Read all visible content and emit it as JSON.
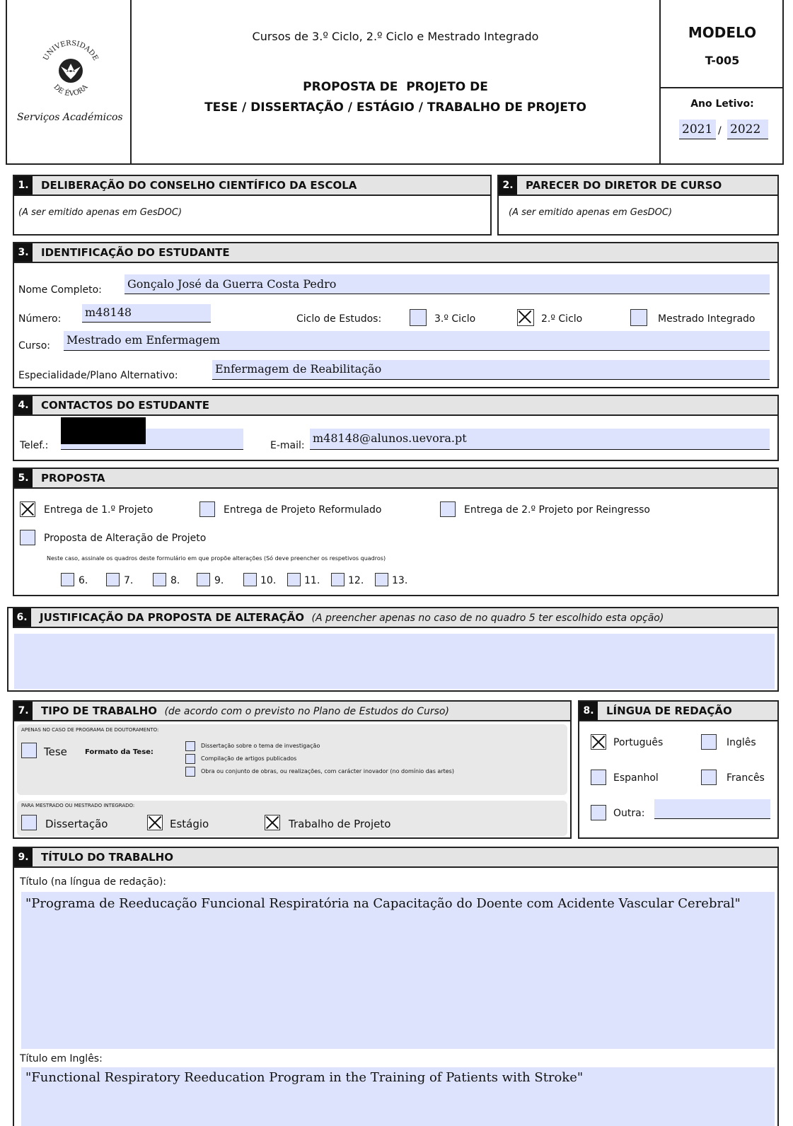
{
  "header": {
    "university_name": "UNIVERSIDADE DE ÉVORA",
    "services": "Serviços Académicos",
    "courses": "Cursos de 3.º Ciclo, 2.º Ciclo e Mestrado Integrado",
    "title_line1": "PROPOSTA DE  PROJETO DE",
    "title_line2": "TESE / DISSERTAÇÃO / ESTÁGIO / TRABALHO DE PROJETO",
    "model_label": "MODELO",
    "model_code": "T-005",
    "year_label": "Ano Letivo:",
    "year_start": "2021",
    "year_sep": "/",
    "year_end": "2022"
  },
  "s1": {
    "num": "1.",
    "title": "DELIBERAÇÃO DO CONSELHO CIENTÍFICO DA ESCOLA",
    "note": "(A ser emitido apenas em GesDOC)"
  },
  "s2": {
    "num": "2.",
    "title": "PARECER DO DIRETOR DE CURSO",
    "note": "(A ser emitido apenas em GesDOC)"
  },
  "s3": {
    "num": "3.",
    "title": "IDENTIFICAÇÃO DO ESTUDANTE",
    "name_label": "Nome Completo:",
    "name_value": "Gonçalo José da Guerra Costa Pedro",
    "number_label": "Número:",
    "number_value": "m48148",
    "cycle_label": "Ciclo de Estudos:",
    "cycle3": "3.º Ciclo",
    "cycle2": "2.º Ciclo",
    "integrated": "Mestrado Integrado",
    "course_label": "Curso:",
    "course_value": "Mestrado em Enfermagem",
    "spec_label": "Especialidade/Plano Alternativo:",
    "spec_value": "Enfermagem de Reabilitação"
  },
  "s4": {
    "num": "4.",
    "title": "CONTACTOS DO ESTUDANTE",
    "phone_label": "Telef.:",
    "email_label": "E-mail:",
    "email_value": "m48148@alunos.uevora.pt"
  },
  "s5": {
    "num": "5.",
    "title": "PROPOSTA",
    "opt1": "Entrega de 1.º Projeto",
    "opt2": "Entrega de Projeto Reformulado",
    "opt3": "Entrega de 2.º Projeto por Reingresso",
    "opt4": "Proposta de Alteração de Projeto",
    "note": "Neste caso, assinale os quadros deste formulário em que propõe alterações (Só deve preencher os respetivos quadros)",
    "quadros": [
      "6.",
      "7.",
      "8.",
      "9.",
      "10.",
      "11.",
      "12.",
      "13."
    ]
  },
  "s6": {
    "num": "6.",
    "title": "JUSTIFICAÇÃO DA PROPOSTA DE ALTERAÇÃO",
    "note": "(A preencher apenas no caso de no quadro 5 ter escolhido esta opção)"
  },
  "s7": {
    "num": "7.",
    "title": "TIPO DE TRABALHO",
    "note": "(de acordo com o previsto no Plano de Estudos do Curso)",
    "phd_label": "APENAS NO CASO DE PROGRAMA DE DOUTORAMENTO:",
    "tese": "Tese",
    "format_label": "Formato da Tese:",
    "f1": "Dissertação sobre o tema de investigação",
    "f2": "Compilação de artigos publicados",
    "f3": "Obra ou conjunto de obras, ou realizações, com carácter inovador (no domínio das artes)",
    "ms_label": "PARA MESTRADO OU MESTRADO INTEGRADO:",
    "dissertacao": "Dissertação",
    "estagio": "Estágio",
    "trabalho": "Trabalho de Projeto"
  },
  "s8": {
    "num": "8.",
    "title": "LÍNGUA DE REDAÇÃO",
    "pt": "Português",
    "en": "Inglês",
    "es": "Espanhol",
    "fr": "Francês",
    "other": "Outra:"
  },
  "s9": {
    "num": "9.",
    "title": "TÍTULO DO TRABALHO",
    "title_label": "Título (na língua de redação):",
    "title_value": "\"Programa de Reeducação Funcional Respiratória na Capacitação do Doente com Acidente Vascular Cerebral\"",
    "en_label": "Título em Inglês:",
    "en_value": "\"Functional Respiratory Reeducation Program in the Training of Patients with Stroke\""
  }
}
